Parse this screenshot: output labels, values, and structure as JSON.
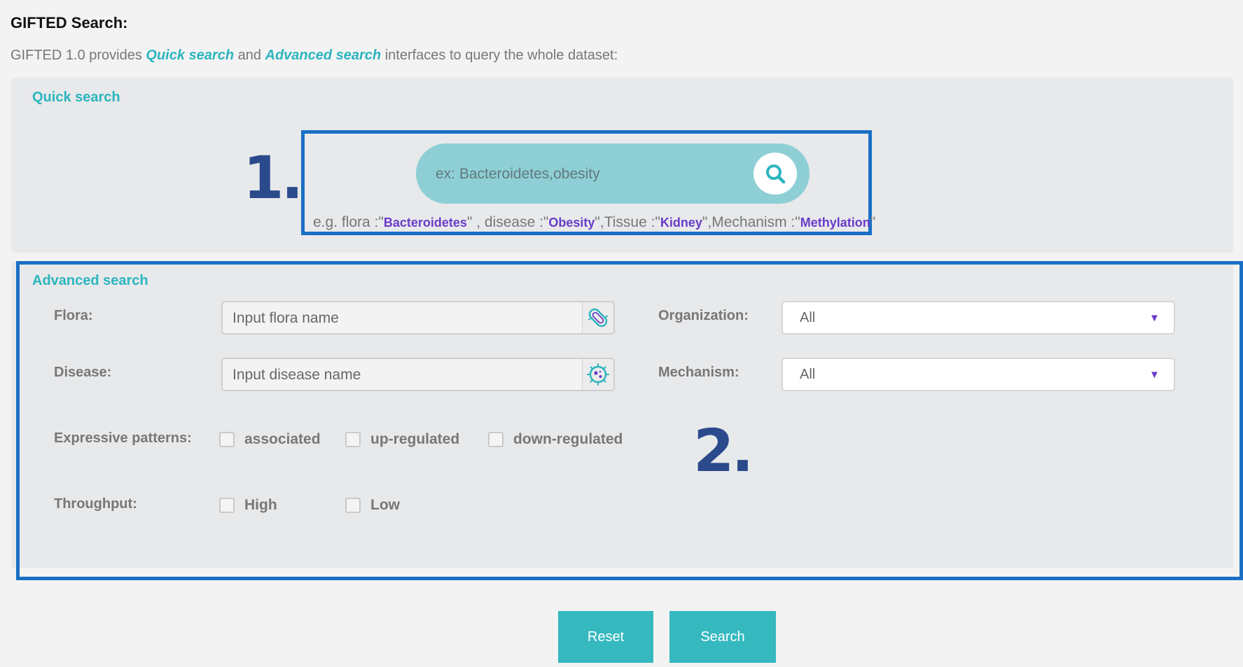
{
  "header": {
    "title": "GIFTED Search:",
    "intro_prefix": "GIFTED 1.0 provides ",
    "intro_quick": "Quick search",
    "intro_and": " and ",
    "intro_advanced": "Advanced search",
    "intro_suffix": " interfaces to query the whole dataset:"
  },
  "quick_search": {
    "title": "Quick search",
    "callout": "1.",
    "placeholder": "ex: Bacteroidetes,obesity",
    "button_icon": "search-icon",
    "example": {
      "prefix": "e.g. flora :\"",
      "flora": "Bacteroidetes",
      "disease_prefix": "\" , disease :\"",
      "disease": "Obesity",
      "tissue_prefix": "\",Tissue :\"",
      "tissue": "Kidney",
      "mechanism_prefix": "\",Mechanism :\"",
      "mechanism": "Methylation",
      "suffix": "\""
    }
  },
  "advanced_search": {
    "title": "Advanced search",
    "callout": "2.",
    "flora": {
      "label": "Flora:",
      "placeholder": "Input flora name",
      "icon": "bacteria-icon"
    },
    "disease": {
      "label": "Disease:",
      "placeholder": "Input disease name",
      "icon": "virus-icon"
    },
    "organization": {
      "label": "Organization:",
      "value": "All"
    },
    "mechanism": {
      "label": "Mechanism:",
      "value": "All"
    },
    "expressive_patterns": {
      "label": "Expressive patterns:",
      "options": [
        "associated",
        "up-regulated",
        "down-regulated"
      ]
    },
    "throughput": {
      "label": "Throughput:",
      "options": [
        "High",
        "Low"
      ]
    }
  },
  "buttons": {
    "reset": "Reset",
    "search": "Search"
  },
  "colors": {
    "accent": "#2bb5bf",
    "keyword": "#6a3cc8",
    "callout_border": "#1a6fc4",
    "button": "#36b8bf"
  }
}
